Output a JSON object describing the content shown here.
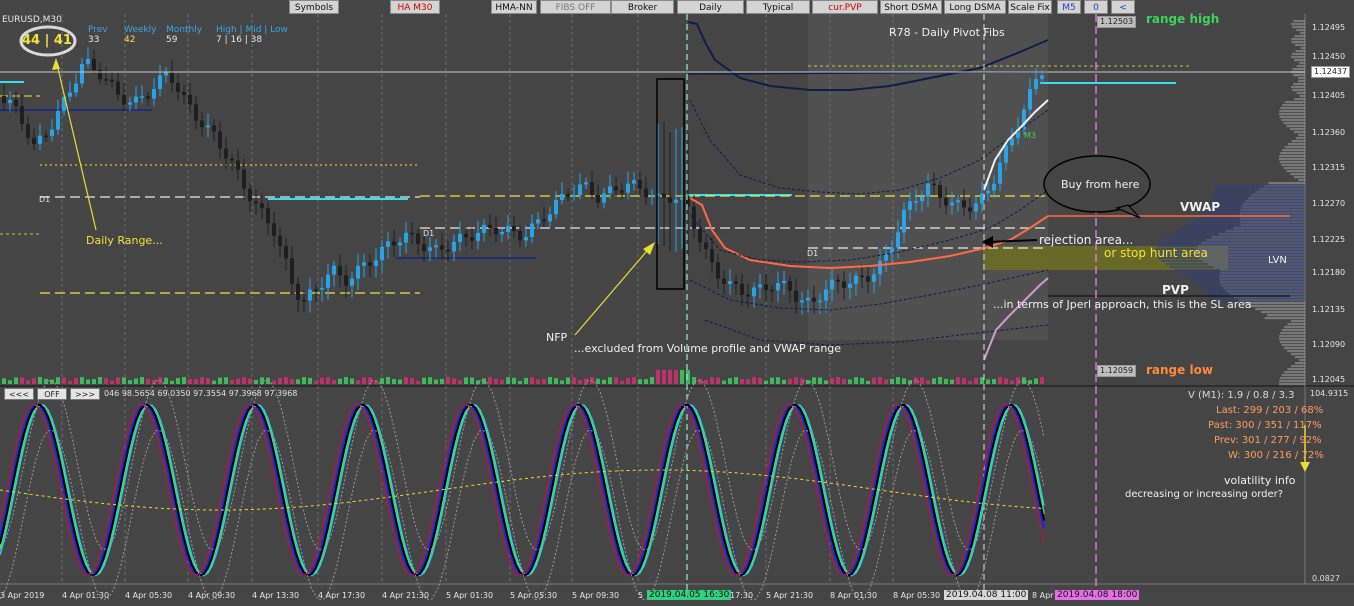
{
  "symbol": "EURUSD,M30",
  "toolbar": {
    "symbols": "Symbols",
    "ha_m30": "HA M30",
    "hma_nn": "HMA-NN",
    "fibs_off": "FIBS OFF",
    "broker": "Broker",
    "daily": "Daily",
    "typical": "Typical",
    "cur_pvp": "cur.PVP",
    "short_dsma": "Short DSMA",
    "long_dsma": "Long DSMA",
    "scale_fix": "Scale Fix",
    "m5": "M5",
    "zero": "0",
    "back": "<"
  },
  "ranges": {
    "prev_label": "Prev",
    "prev_value": "33",
    "weekly_label": "Weekly",
    "weekly_value": "42",
    "monthly_label": "Monthly",
    "monthly_value": "59",
    "hml_label": "High | Mid | Low",
    "hml_value": "7 | 16 | 38",
    "daily_value": "44 | 41"
  },
  "labels": {
    "pivot_title": "R78 - Daily Pivot Fibs",
    "range_high": "range high",
    "range_low": "range low",
    "vwap": "VWAP",
    "lvn": "LVN",
    "pvp": "PVP",
    "buy_from_here": "Buy from here",
    "rejection_area": "rejection area...",
    "stop_hunt": "or stop hunt area",
    "sl_area": "...in terms of  Jperl approach, this is the SL area",
    "daily_range": "Daily Range...",
    "nfp": "NFP",
    "excluded": "...excluded from Volume profile  and VWAP  range",
    "d1": "D1",
    "m3": "M3",
    "volatility_info": "volatility info",
    "vol_order": "decreasing or increasing order?"
  },
  "price_axis": {
    "ticks": [
      "1.12495",
      "1.12450",
      "1.12405",
      "1.12360",
      "1.12315",
      "1.12270",
      "1.12225",
      "1.12180",
      "1.12135",
      "1.12090",
      "1.12045"
    ],
    "current": "1.12437",
    "range_high_price": "1.12503",
    "range_low_price": "1.12059"
  },
  "indicator": {
    "values_text": "046 98.5654 69.0350 97.3554 97.3968 97.3968",
    "top_value": "104.9315",
    "bottom_value": "0.0827",
    "v_line": "V (M1): 1.9 / 0.8 / 3.3",
    "last_line": "Last: 299 / 203 / 68%",
    "past_line": "Past: 300 / 351 / 117%",
    "prev_line": "Prev: 301 / 277 / 92%",
    "w_line": "W: 300 / 216 / 72%"
  },
  "nav": {
    "left": "<<<",
    "off": "OFF",
    "right": ">>>"
  },
  "time_axis": {
    "labels": [
      "3 Apr 2019",
      "4 Apr 01:30",
      "4 Apr 05:30",
      "4 Apr 09:30",
      "4 Apr 13:30",
      "4 Apr 17:30",
      "4 Apr 21:30",
      "5 Apr 01:30",
      "5 Apr 05:30",
      "5 Apr 09:30",
      "5",
      "17:30",
      "5 Apr 21:30",
      "8 Apr 01:30",
      "8 Apr 05:30",
      "8 Apr 1"
    ],
    "highlight1": "2019.04.05 16:30",
    "highlight2": "2019.04.08 11:00",
    "highlight3": "2019.04.08 18:00"
  },
  "colors": {
    "background": "#454545",
    "bull": "#29a3e6",
    "bear": "#1e1e1e",
    "pivot": "#1f2d7a",
    "vwap": "#ff6a45",
    "cyan": "#34e0f0",
    "yellow": "#f2e23a",
    "green_label": "#3dd35a",
    "orange_label": "#ff8a3a",
    "vol_text": "#ff9c5a"
  }
}
